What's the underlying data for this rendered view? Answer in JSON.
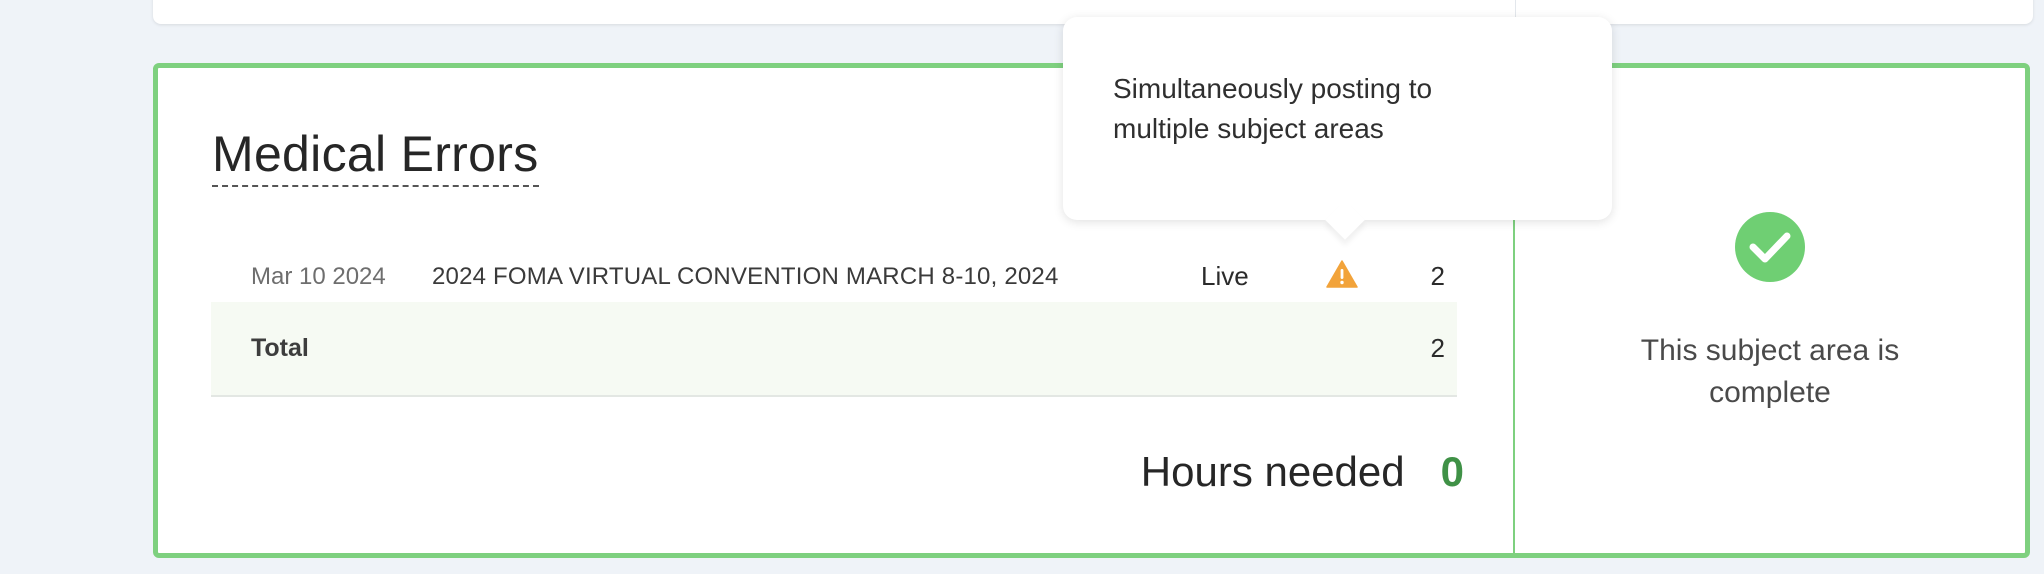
{
  "section": {
    "title": "Medical Errors"
  },
  "entries": [
    {
      "date": "Mar 10 2024",
      "event": "2024 FOMA VIRTUAL CONVENTION MARCH 8-10, 2024",
      "status": "Live",
      "warning_icon": "warning-triangle-icon",
      "count": "2"
    }
  ],
  "total": {
    "label": "Total",
    "count": "2"
  },
  "hours": {
    "label": "Hours needed",
    "value": "0"
  },
  "completion": {
    "icon": "check-circle-icon",
    "text": "This subject area is complete"
  },
  "tooltip": {
    "text": "Simultaneously posting to multiple subject areas"
  },
  "colors": {
    "accent_green": "#7ed07f",
    "check_green": "#6fcf73",
    "hours_value_green": "#3f9146",
    "warning_orange": "#f2a33a"
  }
}
